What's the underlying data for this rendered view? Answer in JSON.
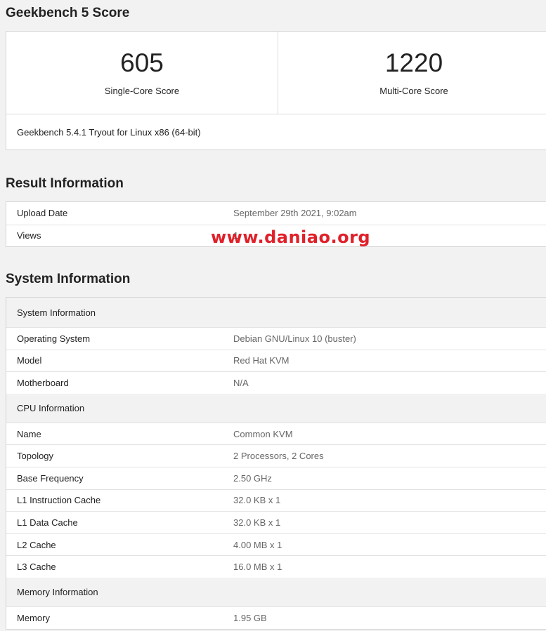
{
  "score_section": {
    "heading": "Geekbench 5 Score",
    "single_core": {
      "value": "605",
      "label": "Single-Core Score"
    },
    "multi_core": {
      "value": "1220",
      "label": "Multi-Core Score"
    },
    "footer": "Geekbench 5.4.1 Tryout for Linux x86 (64-bit)"
  },
  "result_section": {
    "heading": "Result Information",
    "rows": [
      {
        "key": "Upload Date",
        "value": "September 29th 2021, 9:02am"
      },
      {
        "key": "Views",
        "value": "1"
      }
    ]
  },
  "system_section": {
    "heading": "System Information",
    "groups": [
      {
        "title": "System Information",
        "rows": [
          {
            "key": "Operating System",
            "value": "Debian GNU/Linux 10 (buster)"
          },
          {
            "key": "Model",
            "value": "Red Hat KVM"
          },
          {
            "key": "Motherboard",
            "value": "N/A"
          }
        ]
      },
      {
        "title": "CPU Information",
        "rows": [
          {
            "key": "Name",
            "value": "Common KVM"
          },
          {
            "key": "Topology",
            "value": "2 Processors, 2 Cores"
          },
          {
            "key": "Base Frequency",
            "value": "2.50 GHz"
          },
          {
            "key": "L1 Instruction Cache",
            "value": "32.0 KB x 1"
          },
          {
            "key": "L1 Data Cache",
            "value": "32.0 KB x 1"
          },
          {
            "key": "L2 Cache",
            "value": "4.00 MB x 1"
          },
          {
            "key": "L3 Cache",
            "value": "16.0 MB x 1"
          }
        ]
      },
      {
        "title": "Memory Information",
        "rows": [
          {
            "key": "Memory",
            "value": "1.95 GB"
          }
        ]
      }
    ]
  },
  "watermark": {
    "text": "www.daniao.org",
    "color": "#e0202a"
  }
}
